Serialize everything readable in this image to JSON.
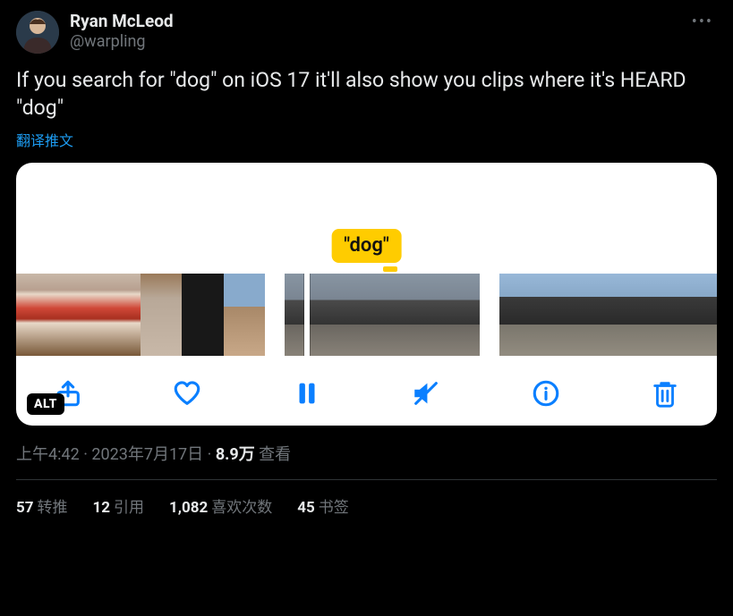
{
  "author": {
    "name": "Ryan McLeod",
    "handle": "@warpling"
  },
  "tweet_text": "If you search for \"dog\" on iOS 17 it'll also show you clips where it's HEARD \"dog\"",
  "translate_label": "翻译推文",
  "media": {
    "label": "\"dog\"",
    "alt_badge": "ALT"
  },
  "meta": {
    "time": "上午4:42",
    "date": "2023年7月17日",
    "views_value": "8.9万",
    "views_label": "查看"
  },
  "engagement": {
    "retweets": {
      "value": "57",
      "label": "转推"
    },
    "quotes": {
      "value": "12",
      "label": "引用"
    },
    "likes": {
      "value": "1,082",
      "label": "喜欢次数"
    },
    "bookmarks": {
      "value": "45",
      "label": "书签"
    }
  }
}
